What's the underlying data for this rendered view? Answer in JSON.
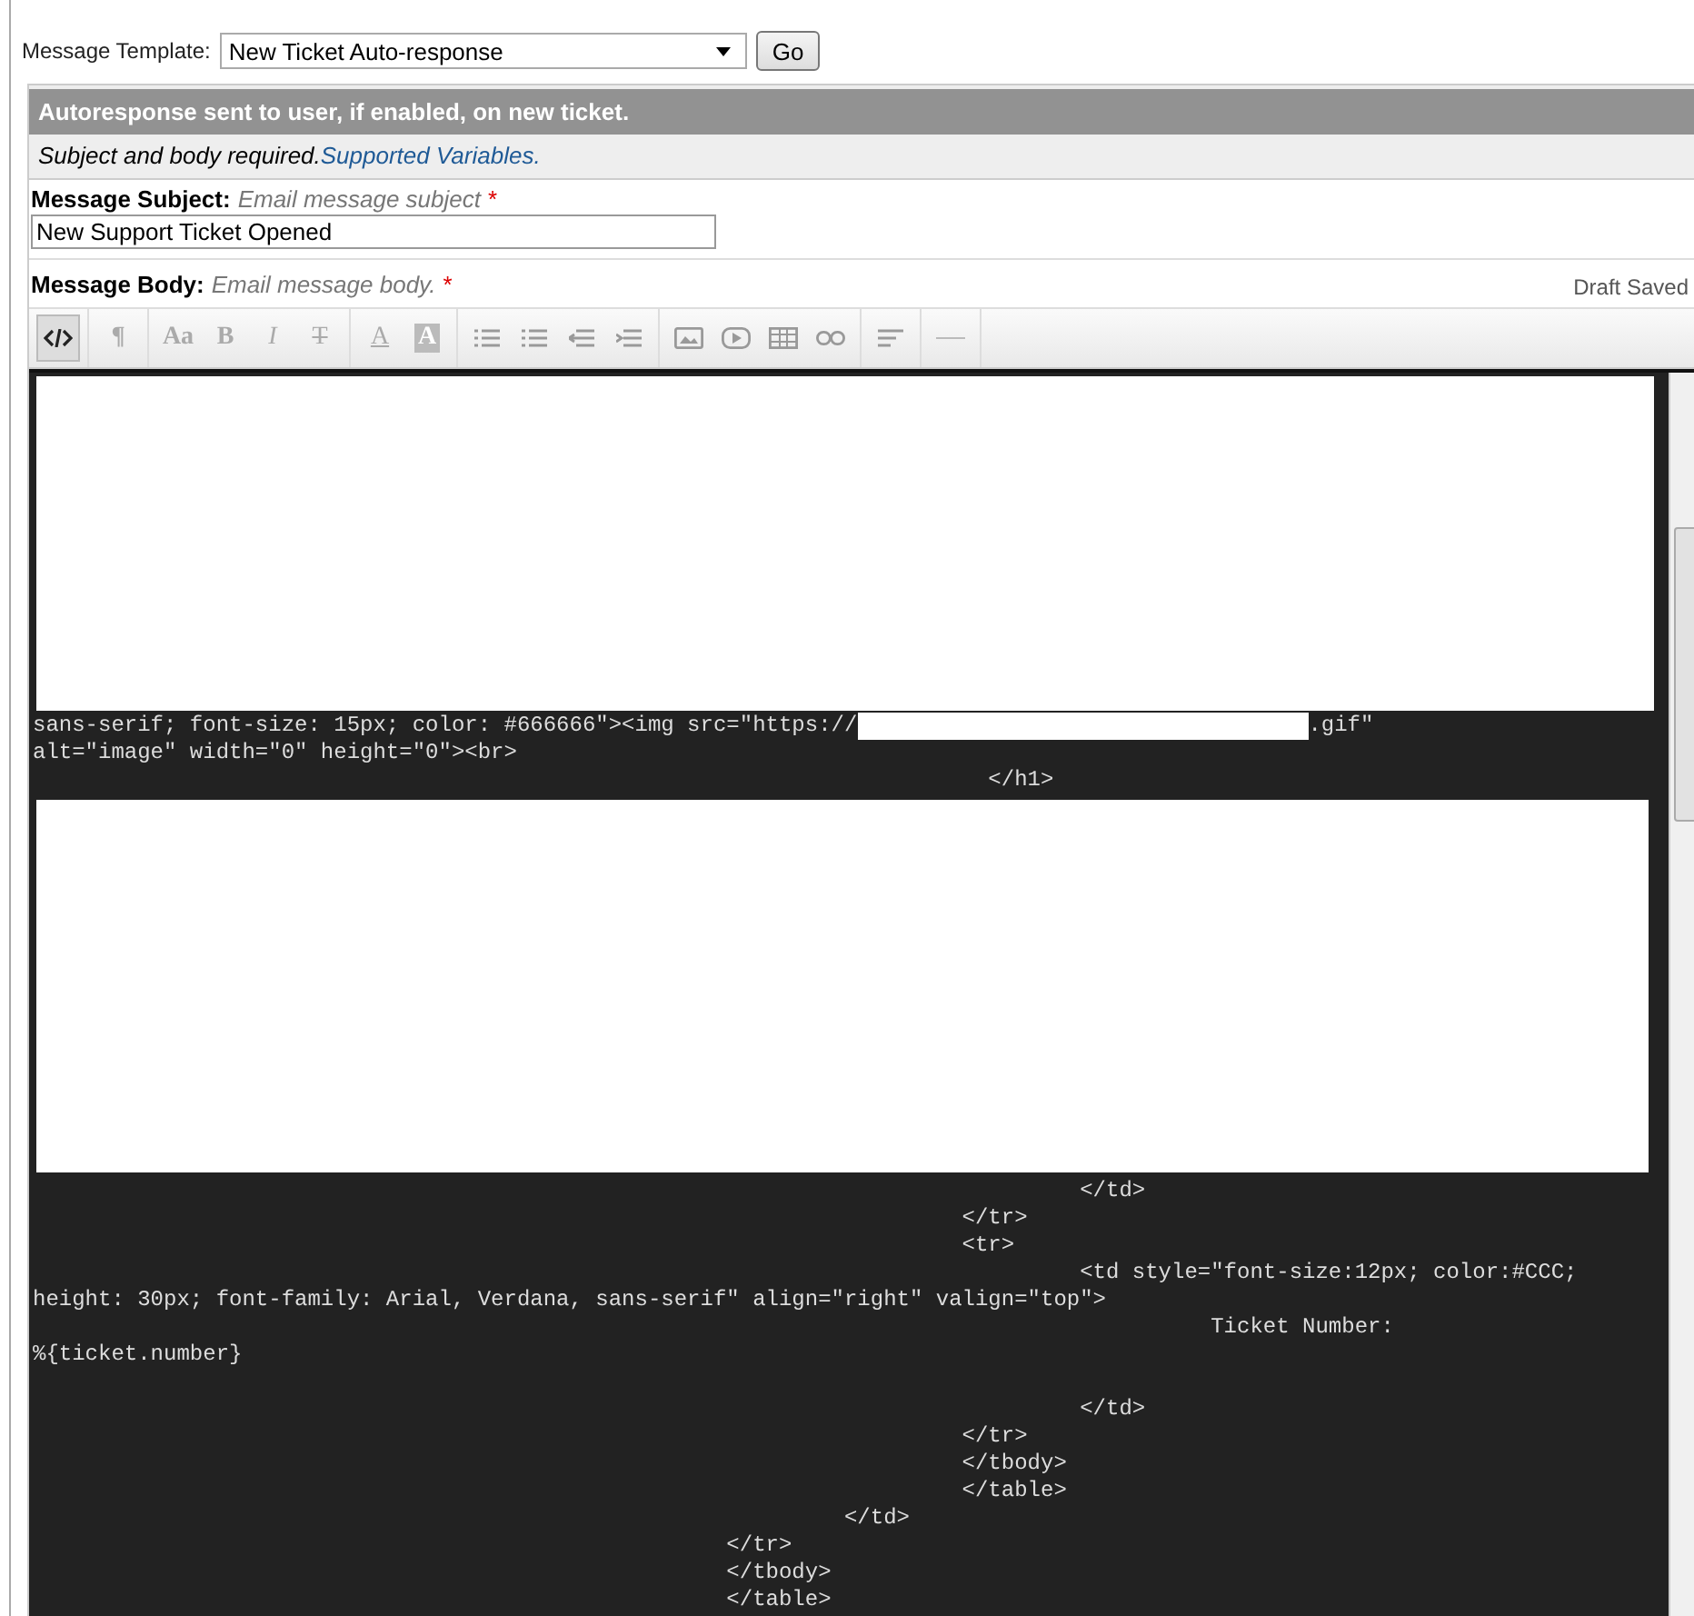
{
  "template_picker": {
    "label": "Message Template:",
    "value": "New Ticket Auto-response",
    "button": "Go"
  },
  "header": {
    "title": "Autoresponse sent to user, if enabled, on new ticket.",
    "note": "Subject and body required.",
    "link": "Supported Variables",
    "link_tail": "."
  },
  "subject": {
    "label": "Message Subject:",
    "hint": "Email message subject",
    "required_mark": "*",
    "value": "New Support Ticket Opened"
  },
  "body": {
    "label": "Message Body:",
    "hint": "Email message body.",
    "required_mark": "*",
    "status": "Draft Saved"
  },
  "toolbar": [
    [
      {
        "kind": "code",
        "selected": true
      }
    ],
    [
      {
        "kind": "glyph",
        "label": "¶",
        "selected": false
      }
    ],
    [
      {
        "kind": "glyph",
        "label": "Aa",
        "selected": false
      },
      {
        "kind": "glyph",
        "label": "B",
        "selected": false
      },
      {
        "kind": "italic",
        "label": "I",
        "selected": false
      },
      {
        "kind": "strike",
        "label": "T",
        "selected": false
      }
    ],
    [
      {
        "kind": "underline",
        "label": "A",
        "selected": false
      },
      {
        "kind": "highlight",
        "label": "A",
        "selected": false
      }
    ],
    [
      {
        "kind": "bullets",
        "selected": false
      },
      {
        "kind": "numbers",
        "selected": false
      },
      {
        "kind": "outdent",
        "selected": false
      },
      {
        "kind": "indent",
        "selected": false
      }
    ],
    [
      {
        "kind": "image",
        "selected": false
      },
      {
        "kind": "video",
        "selected": false
      },
      {
        "kind": "table",
        "selected": false
      },
      {
        "kind": "link",
        "selected": false
      }
    ],
    [
      {
        "kind": "align",
        "selected": false
      }
    ],
    [
      {
        "kind": "rule",
        "selected": false
      }
    ]
  ],
  "code": [
    {
      "kind": "redacted"
    },
    {
      "kind": "line",
      "parts": [
        {
          "kind": "text",
          "text": "sans-serif; font-size: 15px; color: #666666\"><img src=\"https://"
        },
        {
          "kind": "redacted"
        },
        {
          "kind": "text",
          "text": ".gif\""
        }
      ]
    },
    {
      "kind": "line",
      "parts": [
        {
          "kind": "text",
          "text": "alt=\"image\" width=\"0\" height=\"0\"><br>"
        }
      ]
    },
    {
      "kind": "line",
      "parts": [
        {
          "kind": "text",
          "text": "                                                                         </h1>"
        }
      ]
    },
    {
      "kind": "redacted"
    },
    {
      "kind": "line",
      "parts": [
        {
          "kind": "text",
          "text": "                                                                                </td>"
        }
      ]
    },
    {
      "kind": "line",
      "parts": [
        {
          "kind": "text",
          "text": "                                                                       </tr>"
        }
      ]
    },
    {
      "kind": "line",
      "parts": [
        {
          "kind": "text",
          "text": "                                                                       <tr>"
        }
      ]
    },
    {
      "kind": "line",
      "parts": [
        {
          "kind": "text",
          "text": "                                                                                <td style=\"font-size:12px; color:#CCC;"
        }
      ]
    },
    {
      "kind": "line",
      "parts": [
        {
          "kind": "text",
          "text": "height: 30px; font-family: Arial, Verdana, sans-serif\" align=\"right\" valign=\"top\">"
        }
      ]
    },
    {
      "kind": "line",
      "parts": [
        {
          "kind": "text",
          "text": "                                                                                          Ticket Number:"
        }
      ]
    },
    {
      "kind": "line",
      "parts": [
        {
          "kind": "text",
          "text": "%{ticket.number}"
        }
      ]
    },
    {
      "kind": "blank"
    },
    {
      "kind": "line",
      "parts": [
        {
          "kind": "text",
          "text": "                                                                                </td>"
        }
      ]
    },
    {
      "kind": "line",
      "parts": [
        {
          "kind": "text",
          "text": "                                                                       </tr>"
        }
      ]
    },
    {
      "kind": "line",
      "parts": [
        {
          "kind": "text",
          "text": "                                                                       </tbody>"
        }
      ]
    },
    {
      "kind": "line",
      "parts": [
        {
          "kind": "text",
          "text": "                                                                       </table>"
        }
      ]
    },
    {
      "kind": "line",
      "parts": [
        {
          "kind": "text",
          "text": "                                                              </td>"
        }
      ]
    },
    {
      "kind": "line",
      "parts": [
        {
          "kind": "text",
          "text": "                                                     </tr>"
        }
      ]
    },
    {
      "kind": "line",
      "parts": [
        {
          "kind": "text",
          "text": "                                                     </tbody>"
        }
      ]
    },
    {
      "kind": "line",
      "parts": [
        {
          "kind": "text",
          "text": "                                                     </table>"
        }
      ]
    }
  ]
}
